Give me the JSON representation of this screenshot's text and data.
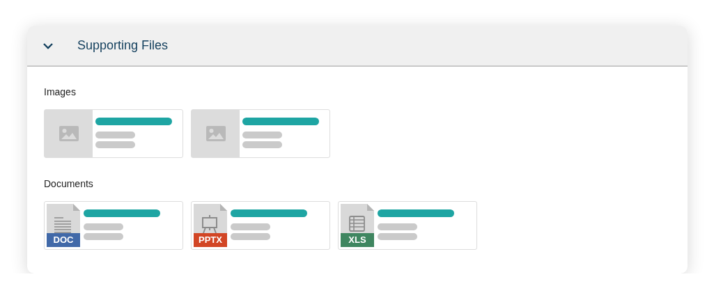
{
  "panel": {
    "title": "Supporting Files",
    "expanded": true
  },
  "sections": [
    {
      "label": "Images",
      "files": [
        {
          "kind": "image"
        },
        {
          "kind": "image"
        }
      ]
    },
    {
      "label": "Documents",
      "files": [
        {
          "kind": "doc",
          "badge": "DOC",
          "color": "#4169a8"
        },
        {
          "kind": "slides",
          "badge": "PPTX",
          "color": "#d24625"
        },
        {
          "kind": "sheet",
          "badge": "XLS",
          "color": "#3f8660"
        }
      ]
    }
  ]
}
